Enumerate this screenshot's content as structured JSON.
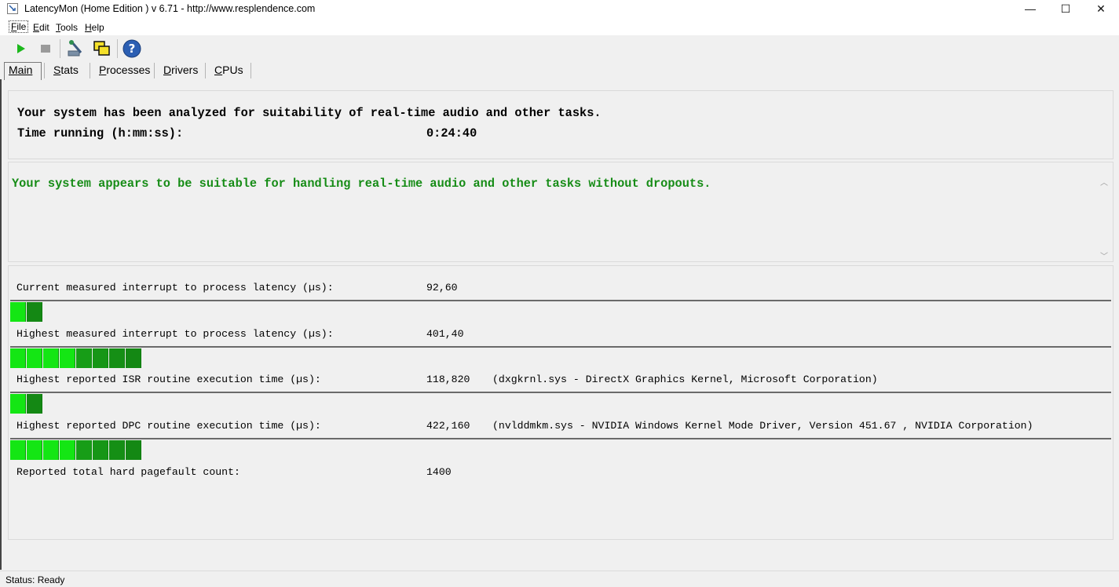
{
  "window": {
    "title": "LatencyMon  (Home Edition )  v 6.71 - http://www.resplendence.com",
    "minimize_glyph": "—",
    "maximize_glyph": "☐",
    "close_glyph": "✕"
  },
  "menu": [
    {
      "accel": "F",
      "rest": "ile"
    },
    {
      "accel": "E",
      "rest": "dit"
    },
    {
      "accel": "T",
      "rest": "ools"
    },
    {
      "accel": "H",
      "rest": "elp"
    }
  ],
  "toolbar": {
    "icons": [
      "play-icon",
      "stop-icon",
      "driver-tool-icon",
      "windows-copy-icon",
      "help-icon"
    ],
    "help_glyph": "?"
  },
  "tabs": [
    {
      "accel": "M",
      "rest": "ain"
    },
    {
      "accel": "S",
      "rest": "tats"
    },
    {
      "accel": "P",
      "rest": "rocesses"
    },
    {
      "accel": "D",
      "rest": "rivers"
    },
    {
      "accel": "C",
      "rest": "PUs"
    }
  ],
  "summary": {
    "line1": "Your system has been analyzed for suitability of real-time audio and other tasks.",
    "time_label": "Time running (h:mm:ss):",
    "time_value": "0:24:40"
  },
  "verdict": {
    "text": "Your system appears to be suitable for handling real-time audio and other tasks without dropouts.",
    "color": "#168c16"
  },
  "metrics": [
    {
      "label": "Current measured interrupt to process latency (µs):",
      "value": "92,60",
      "extra": "",
      "bar_segments": 2
    },
    {
      "label": "Highest measured interrupt to process latency (µs):",
      "value": "401,40",
      "extra": "",
      "bar_segments": 8
    },
    {
      "label": "Highest reported ISR routine execution time (µs):",
      "value": "118,820",
      "extra": "(dxgkrnl.sys - DirectX Graphics Kernel, Microsoft Corporation)",
      "bar_segments": 2
    },
    {
      "label": "Highest reported DPC routine execution time (µs):",
      "value": "422,160",
      "extra": "(nvlddmkm.sys - NVIDIA Windows Kernel Mode Driver, Version 451.67 , NVIDIA Corporation)",
      "bar_segments": 8
    },
    {
      "label": "Reported total hard pagefault count:",
      "value": "1400",
      "extra": ""
    }
  ],
  "status": {
    "text": "Status: Ready"
  },
  "colors": {
    "bar_bright": "#14e614",
    "bar_dark": "#18a018"
  }
}
